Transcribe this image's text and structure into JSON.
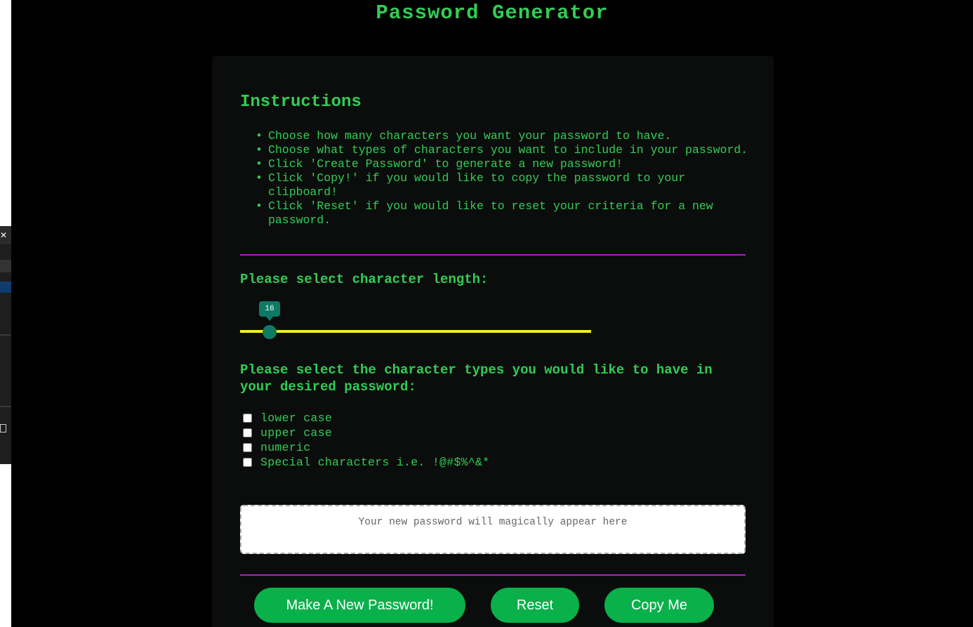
{
  "page": {
    "title": "Password Generator"
  },
  "instructions": {
    "title": "Instructions",
    "items": [
      "Choose how many characters you want your password to have.",
      "Choose what types of characters you want to include in your password.",
      "Click 'Create Password' to generate a new password!",
      "Click 'Copy!' if you would like to copy the password to your clipboard!",
      "Click 'Reset' if you would like to reset your criteria for a new password."
    ]
  },
  "length": {
    "label": "Please select character length:",
    "value": "16"
  },
  "types": {
    "label": "Please select the character types you would like to have in your desired password:",
    "options": [
      {
        "label": "lower case",
        "checked": false
      },
      {
        "label": "upper case",
        "checked": false
      },
      {
        "label": "numeric",
        "checked": false
      },
      {
        "label": "Special characters i.e. !@#$%^&*",
        "checked": false
      }
    ]
  },
  "output": {
    "placeholder": "Your new password will magically appear here",
    "value": ""
  },
  "buttons": {
    "generate_label": "Make A New Password!",
    "reset_label": "Reset",
    "copy_label": "Copy Me"
  },
  "colors": {
    "accent_green": "#33cc55",
    "button_green": "#0ab04a",
    "divider_purple": "#aa22bb",
    "slider_track": "#f2ee1e",
    "slider_thumb": "#0e7a66"
  }
}
